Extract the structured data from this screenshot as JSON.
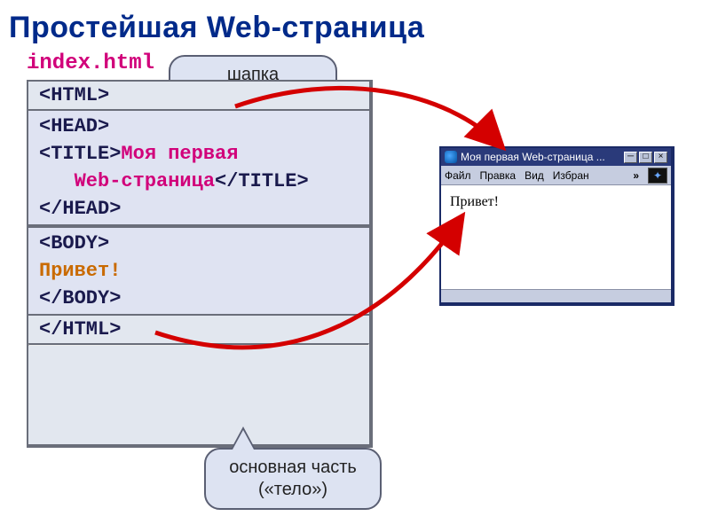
{
  "title": "Простейшая Web-страница",
  "filename": "index.html",
  "callouts": {
    "top": "шапка («голова»)",
    "bottom_line1": "основная часть",
    "bottom_line2": "(«тело»)"
  },
  "code": {
    "html_open": "<HTML>",
    "head_open": "<HEAD>",
    "title_open": "<TITLE>",
    "title_text1": "Моя первая",
    "title_text2": "Web-страница",
    "title_close": "</TITLE>",
    "head_close": "</HEAD>",
    "body_open": "<BODY>",
    "body_text": "Привет!",
    "body_close": "</BODY>",
    "html_close": "</HTML>"
  },
  "browser": {
    "title": "Моя первая Web-страница ...",
    "menu": {
      "file": "Файл",
      "edit": "Правка",
      "view": "Вид",
      "fav": "Избран",
      "more": "»"
    },
    "page_text": "Привет!"
  }
}
